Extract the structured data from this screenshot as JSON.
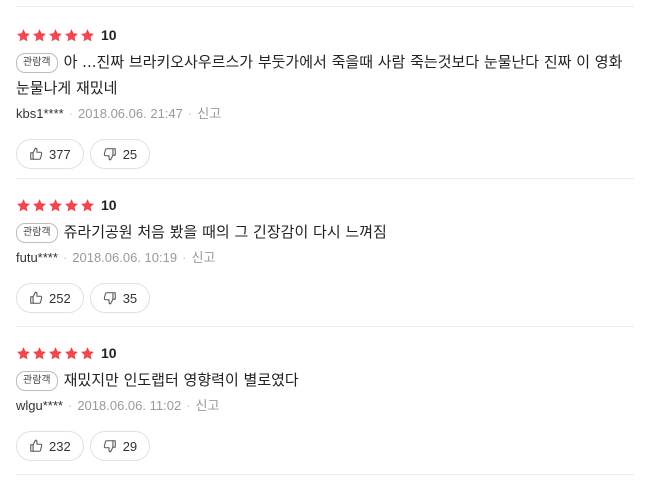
{
  "accent": {
    "star": "#f0484d"
  },
  "reviews": [
    {
      "stars": 5,
      "score": "10",
      "badge": "관람객",
      "text": "아 ...진짜 브라키오사우르스가 부둣가에서 죽을때 사람 죽는것보다 눈물난다 진짜 이 영화 눈물나게 재밌네",
      "user": "kbs1****",
      "date": "2018.06.06. 21:47",
      "report": "신고",
      "likes": "377",
      "dislikes": "25"
    },
    {
      "stars": 5,
      "score": "10",
      "badge": "관람객",
      "text": "쥬라기공원 처음 봤을 때의 그 긴장감이 다시 느껴짐",
      "user": "futu****",
      "date": "2018.06.06. 10:19",
      "report": "신고",
      "likes": "252",
      "dislikes": "35"
    },
    {
      "stars": 5,
      "score": "10",
      "badge": "관람객",
      "text": "재밌지만 인도랩터 영향력이 별로였다",
      "user": "wlgu****",
      "date": "2018.06.06. 11:02",
      "report": "신고",
      "likes": "232",
      "dislikes": "29"
    }
  ],
  "icons": {
    "like": "thumbs-up-icon",
    "dislike": "thumbs-down-icon",
    "star": "star-icon"
  }
}
